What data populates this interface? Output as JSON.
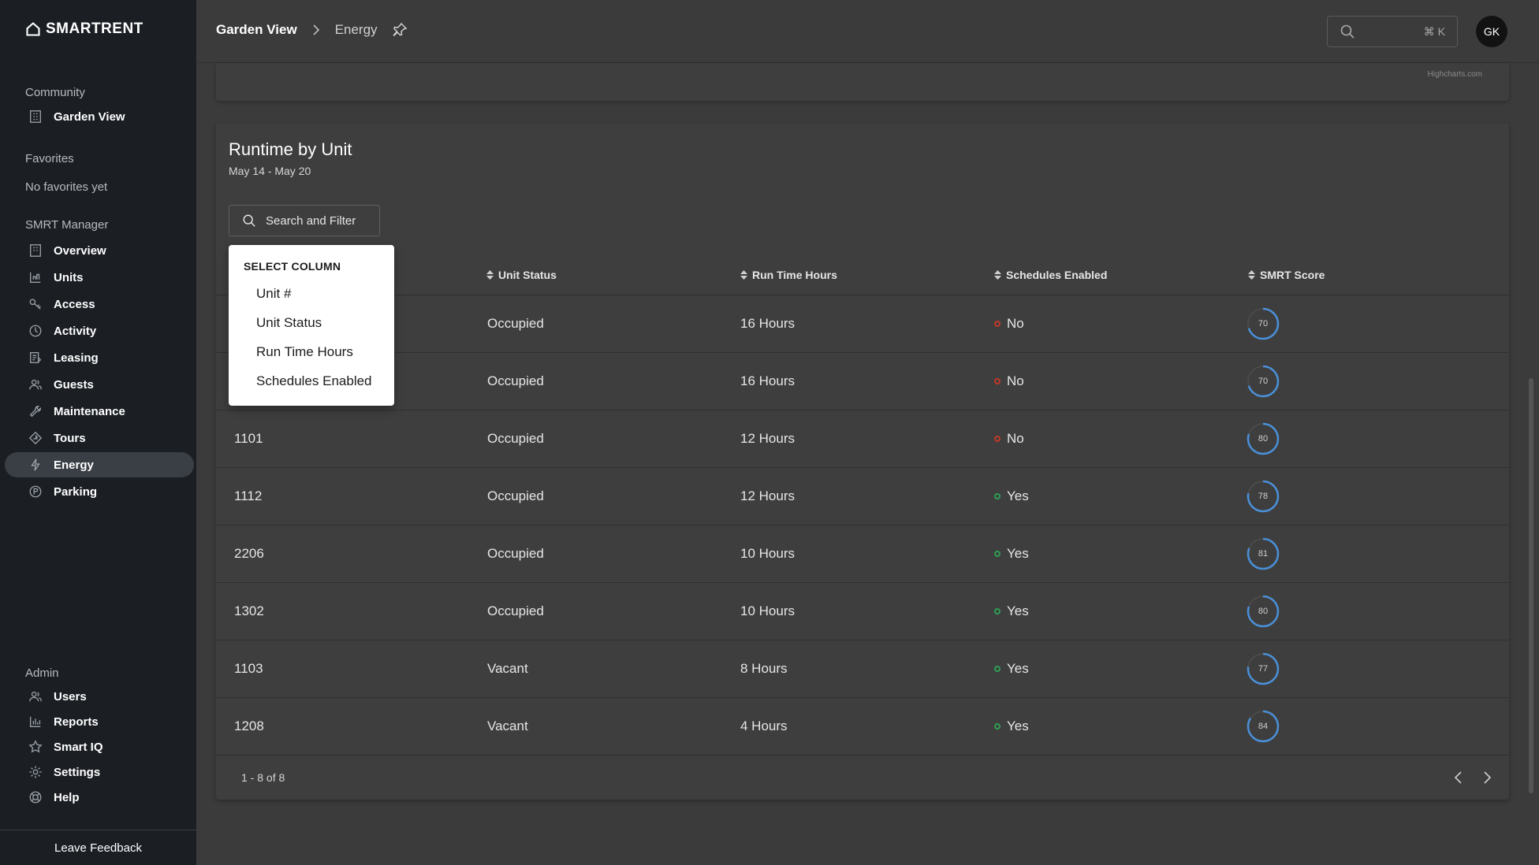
{
  "brand": {
    "logo_text": "SmartRent"
  },
  "sidebar": {
    "community_label": "Community",
    "community_name": "Garden View",
    "favorites_label": "Favorites",
    "no_favorites": "No favorites yet",
    "manager_label": "SMRT Manager",
    "items": [
      {
        "label": "Overview",
        "icon": "building-icon"
      },
      {
        "label": "Units",
        "icon": "units-icon"
      },
      {
        "label": "Access",
        "icon": "key-icon"
      },
      {
        "label": "Activity",
        "icon": "clock-icon"
      },
      {
        "label": "Leasing",
        "icon": "leasing-icon"
      },
      {
        "label": "Guests",
        "icon": "guests-icon"
      },
      {
        "label": "Maintenance",
        "icon": "wrench-icon"
      },
      {
        "label": "Tours",
        "icon": "tours-icon"
      },
      {
        "label": "Energy",
        "icon": "bolt-icon",
        "active": true
      },
      {
        "label": "Parking",
        "icon": "parking-icon"
      }
    ],
    "admin_label": "Admin",
    "admin_items": [
      {
        "label": "Users",
        "icon": "users-icon"
      },
      {
        "label": "Reports",
        "icon": "reports-icon"
      },
      {
        "label": "Smart IQ",
        "icon": "star-icon"
      },
      {
        "label": "Settings",
        "icon": "gear-icon"
      },
      {
        "label": "Help",
        "icon": "help-icon"
      }
    ],
    "feedback": "Leave Feedback"
  },
  "header": {
    "breadcrumb_root": "Garden View",
    "breadcrumb_current": "Energy",
    "search_shortcut": "⌘ K",
    "avatar_initials": "GK"
  },
  "chart_credits": "Highcharts.com",
  "runtime": {
    "title": "Runtime by Unit",
    "date_range": "May 14 - May 20",
    "filter_label": "Search and Filter",
    "columns": [
      "Unit #",
      "Unit Status",
      "Run Time Hours",
      "Schedules Enabled",
      "SMRT Score"
    ],
    "rows": [
      {
        "unit": "",
        "status": "Occupied",
        "hours": "16 Hours",
        "schedules": "No",
        "score": 70
      },
      {
        "unit": "",
        "status": "Occupied",
        "hours": "16 Hours",
        "schedules": "No",
        "score": 70
      },
      {
        "unit": "1101",
        "status": "Occupied",
        "hours": "12 Hours",
        "schedules": "No",
        "score": 80
      },
      {
        "unit": "1112",
        "status": "Occupied",
        "hours": "12 Hours",
        "schedules": "Yes",
        "score": 78
      },
      {
        "unit": "2206",
        "status": "Occupied",
        "hours": "10 Hours",
        "schedules": "Yes",
        "score": 81
      },
      {
        "unit": "1302",
        "status": "Occupied",
        "hours": "10 Hours",
        "schedules": "Yes",
        "score": 80
      },
      {
        "unit": "1103",
        "status": "Vacant",
        "hours": "8 Hours",
        "schedules": "Yes",
        "score": 77
      },
      {
        "unit": "1208",
        "status": "Vacant",
        "hours": "4 Hours",
        "schedules": "Yes",
        "score": 84
      }
    ],
    "pagination": "1 - 8 of 8"
  },
  "column_menu": {
    "title": "SELECT COLUMN",
    "options": [
      "Unit #",
      "Unit Status",
      "Run Time Hours",
      "Schedules Enabled"
    ]
  },
  "colors": {
    "score_ring": "#4a90d9",
    "no": "#c0392b",
    "yes": "#2e9e53"
  }
}
